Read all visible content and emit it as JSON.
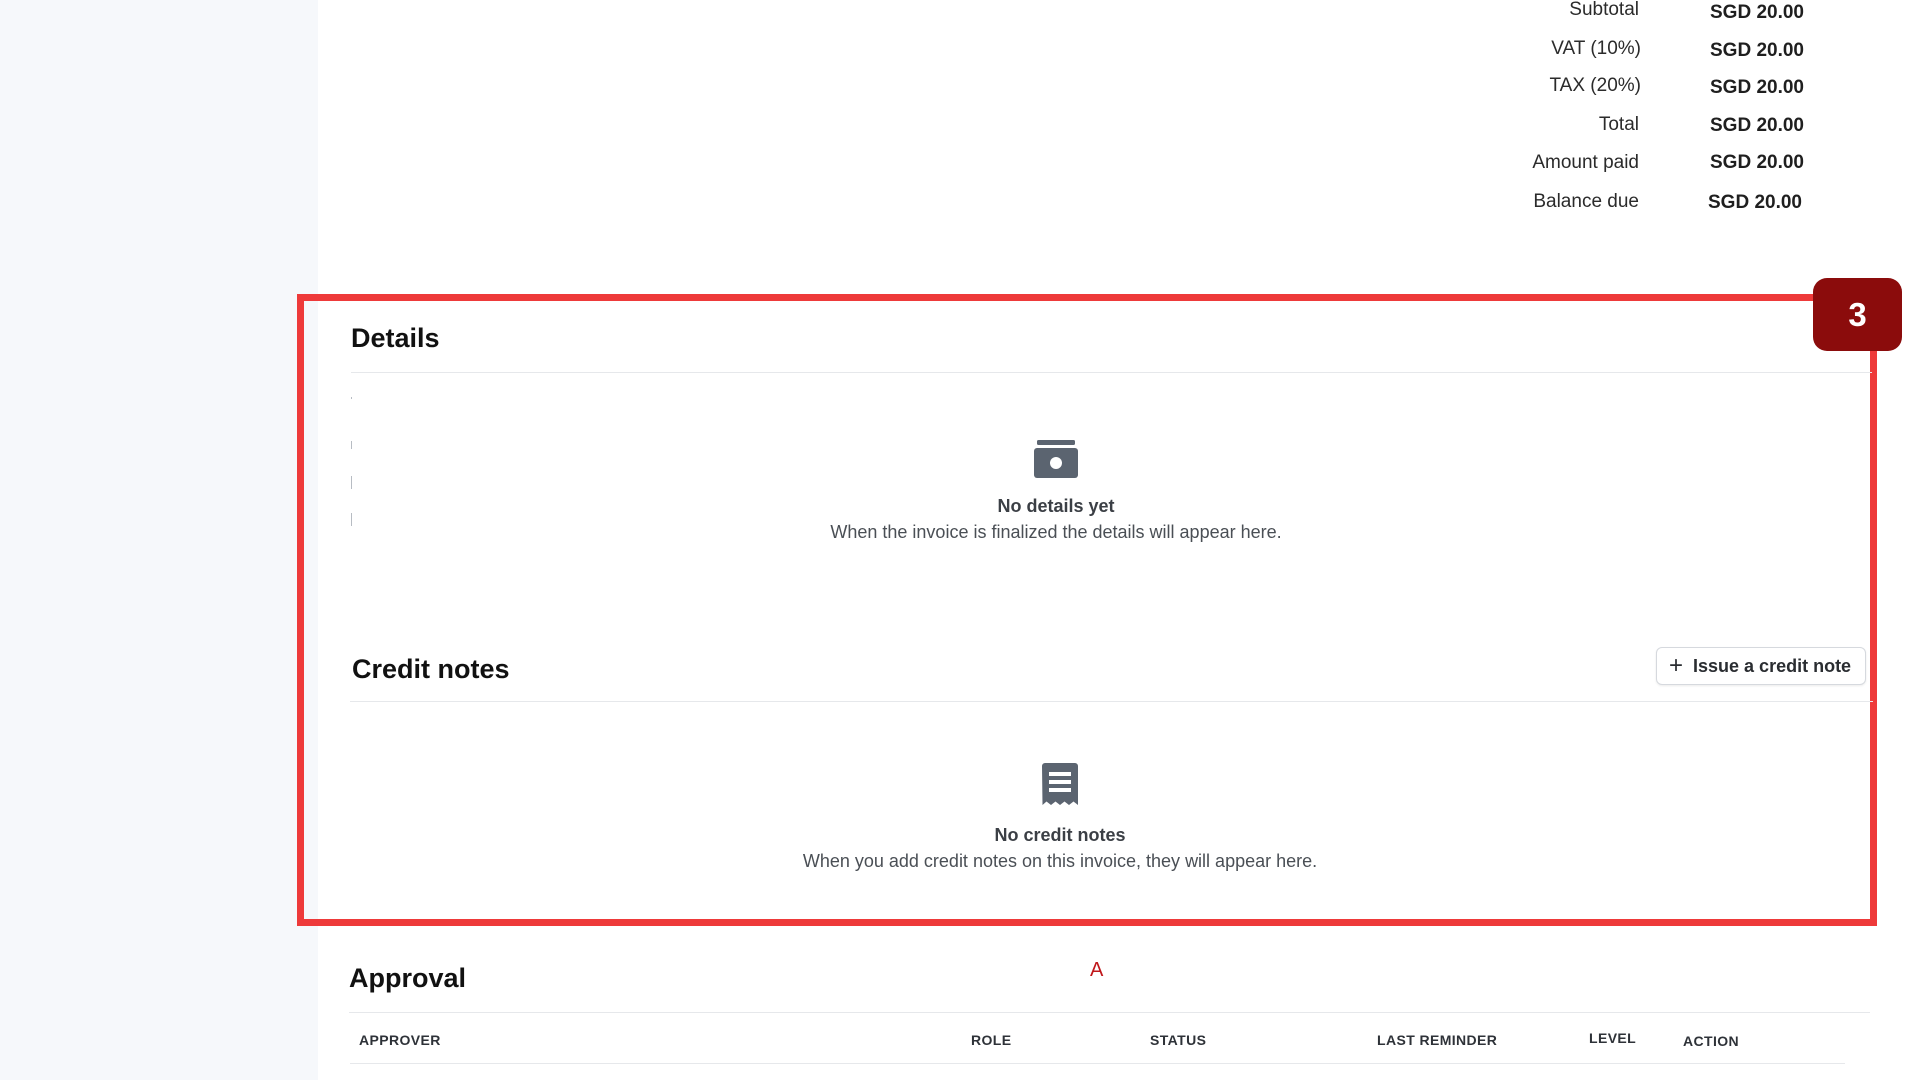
{
  "totals": [
    {
      "label": "Subtotal",
      "value": "SGD 20.00"
    },
    {
      "label": "VAT (10%)",
      "value": "SGD 20.00"
    },
    {
      "label": "TAX (20%)",
      "value": "SGD 20.00"
    },
    {
      "label": "Total",
      "value": "SGD 20.00"
    },
    {
      "label": "Amount paid",
      "value": "SGD 20.00"
    },
    {
      "label": "Balance due",
      "value": "SGD 20.00"
    }
  ],
  "step_badge": "3",
  "details": {
    "title": "Details",
    "icon": "camera-box-icon",
    "empty_title": "No details yet",
    "empty_desc": "When the invoice is finalized the details will appear here."
  },
  "credit_notes": {
    "title": "Credit notes",
    "button_label": "Issue a credit note",
    "icon": "receipt-icon",
    "empty_title": "No credit notes",
    "empty_desc": "When you add credit notes on this invoice, they will appear here."
  },
  "approval": {
    "title": "Approval",
    "marker": "A",
    "columns": [
      "APPROVER",
      "ROLE",
      "STATUS",
      "LAST REMINDER",
      "LEVEL",
      "ACTION"
    ]
  },
  "colors": {
    "highlight": "#ee3a3a",
    "badge": "#8b0c0c",
    "sidebar": "#f6f8fb",
    "icon": "#5b6470"
  }
}
